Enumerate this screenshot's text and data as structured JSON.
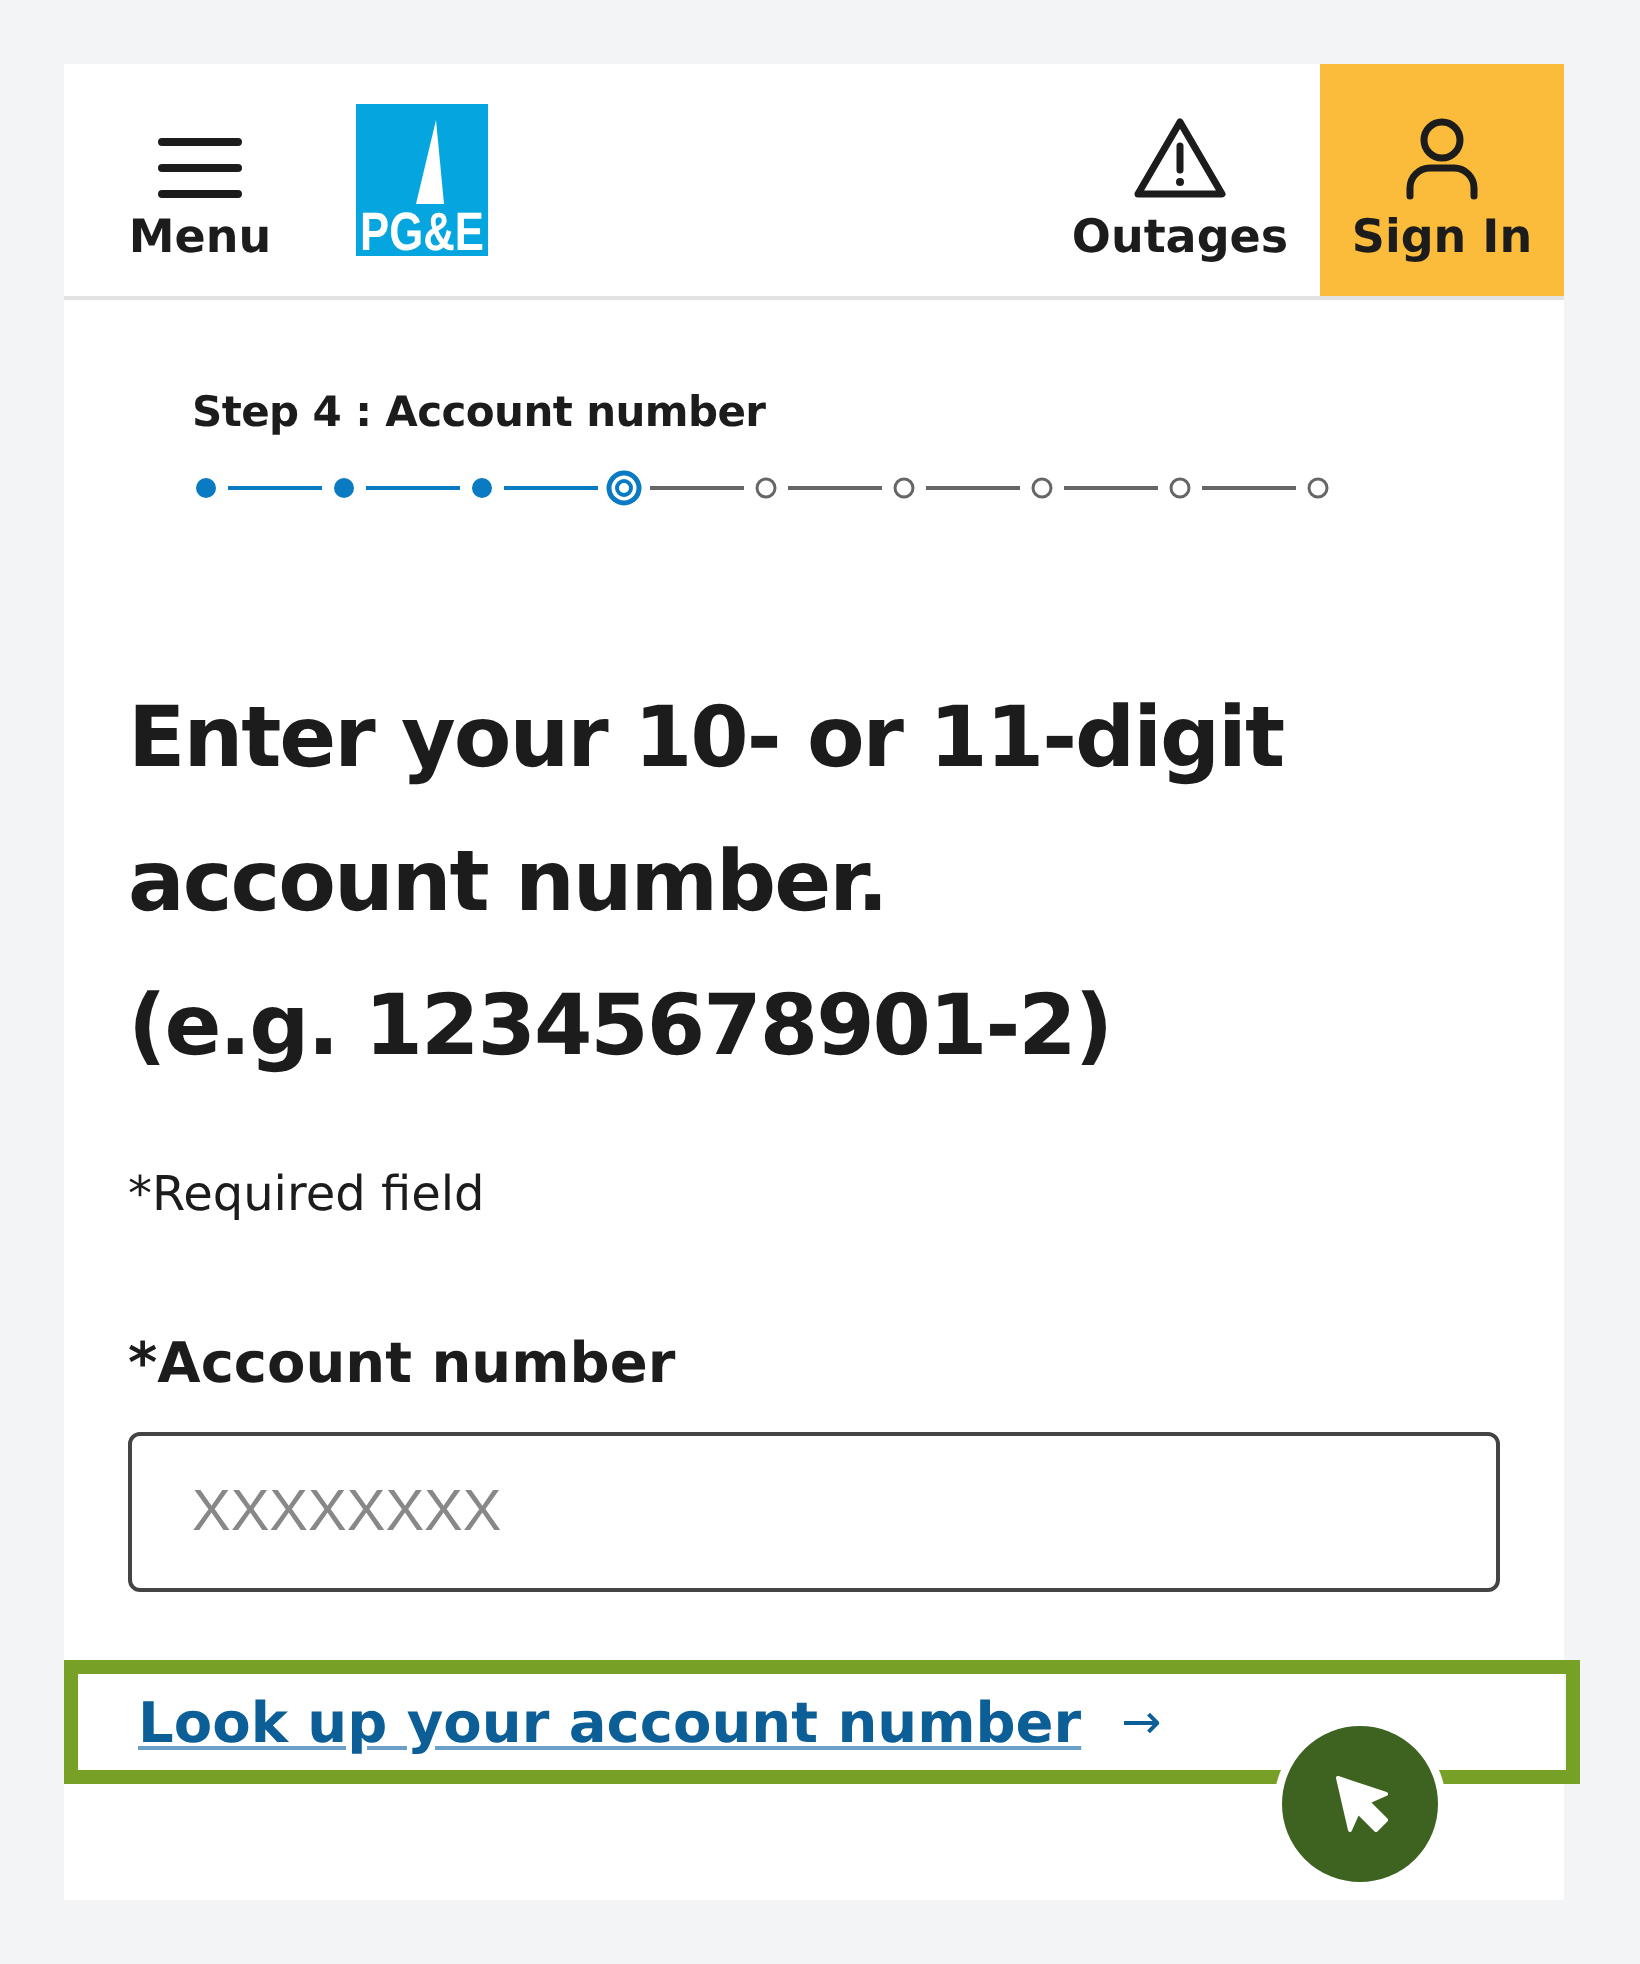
{
  "header": {
    "menu_label": "Menu",
    "logo_text": "PG&E",
    "outages_label": "Outages",
    "sign_in_label": "Sign In"
  },
  "progress": {
    "title": "Step 4 :  Account number",
    "steps": [
      {
        "kind": "done"
      },
      {
        "kind": "done"
      },
      {
        "kind": "done"
      },
      {
        "kind": "current"
      },
      {
        "kind": "upcoming"
      },
      {
        "kind": "upcoming"
      },
      {
        "kind": "upcoming"
      },
      {
        "kind": "upcoming"
      },
      {
        "kind": "upcoming"
      }
    ]
  },
  "heading": "Enter your 10- or 11-digit account number.\n(e.g. 12345678901-2)",
  "required_note": "*Required field",
  "field": {
    "label": "*Account number",
    "placeholder": "XXXXXXXX"
  },
  "lookup_link": {
    "label": "Look up your account number",
    "arrow": "→",
    "highlighted": true
  }
}
